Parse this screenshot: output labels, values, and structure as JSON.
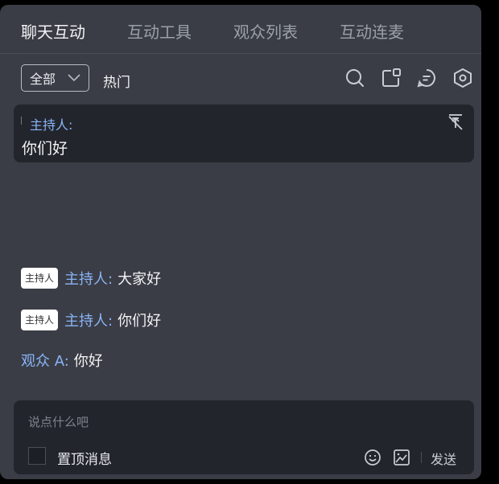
{
  "tabs": [
    {
      "label": "聊天互动",
      "active": true
    },
    {
      "label": "互动工具",
      "active": false
    },
    {
      "label": "观众列表",
      "active": false
    },
    {
      "label": "互动连麦",
      "active": false
    }
  ],
  "toolbar": {
    "filter_value": "全部",
    "hot_label": "热门",
    "icons": [
      "search-icon",
      "share-screen-icon",
      "chat-bubble-icon",
      "settings-hex-icon"
    ]
  },
  "pinned": {
    "sender": "主持人:",
    "message": "你们好"
  },
  "messages": [
    {
      "badge": "主持人",
      "sender": "主持人:",
      "text": "大家好"
    },
    {
      "badge": "主持人",
      "sender": "主持人:",
      "text": "你们好"
    },
    {
      "badge": "",
      "sender": "观众 A:",
      "text": "你好"
    }
  ],
  "composer": {
    "placeholder": "说点什么吧",
    "pin_label": "置顶消息",
    "send_label": "发送"
  },
  "colors": {
    "panel": "#3a3d45",
    "card": "#22252c",
    "accent": "#8ab4f8",
    "text": "#f2f3f5"
  }
}
